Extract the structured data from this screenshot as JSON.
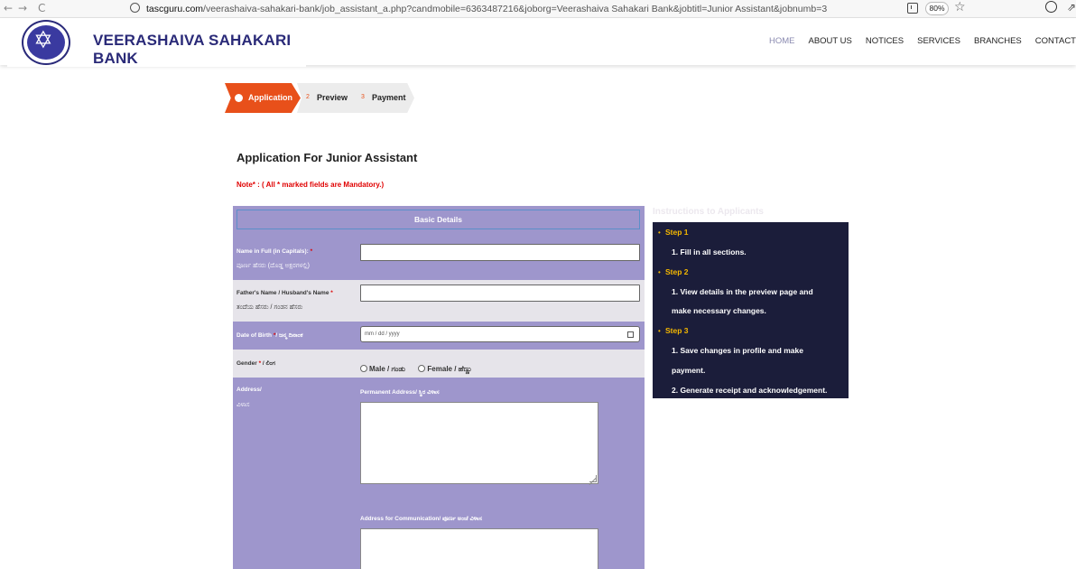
{
  "browser": {
    "back": "←",
    "forward": "→",
    "reload": "C",
    "url_host": "tascguru.com",
    "url_path": "/veerashaiva-sahakari-bank/job_assistant_a.php?candmobile=6363487216&joborg=Veerashaiva Sahakari Bank&jobtitl=Junior Assistant&jobnumb=3",
    "zoom": "80%",
    "star": "☆",
    "ext": "⇗"
  },
  "header": {
    "bank_name": "VEERASHAIVA SAHAKARI BANK",
    "nav": [
      "HOME",
      "ABOUT US",
      "NOTICES",
      "SERVICES",
      "BRANCHES",
      "CONTACT"
    ]
  },
  "stepper": {
    "steps": [
      {
        "num": "",
        "label": "Application"
      },
      {
        "num": "2",
        "label": "Preview"
      },
      {
        "num": "3",
        "label": "Payment"
      }
    ]
  },
  "page": {
    "title": "Application For Junior Assistant",
    "note": "Note* : ( All * marked fields are Mandatory.)"
  },
  "form": {
    "section_title": "Basic Details",
    "name_label": "Name in Full (in Capitals):",
    "name_sub": "ಪೂರ್ಣ ಹೆಸರು (ದೊಡ್ಡ ಅಕ್ಷರಗಳಲ್ಲಿ)",
    "father_label": "Father's Name / Husband's Name",
    "father_sub": "ತಂದೆಯ ಹೆಸರು / ಗಂಡನ ಹೆಸರು",
    "dob_label": "Date of Birth",
    "dob_sub": "/ ಜನ್ಮ ದಿನಾಂಕ",
    "dob_placeholder": "mm / dd / yyyy",
    "gender_label": "Gender",
    "gender_sub": "/ ಲಿಂಗ",
    "gender_male": "Male / ಗಂಡು",
    "gender_female": "Female / ಹೆಣ್ಣು",
    "required_mark": "*",
    "address_label": "Address/",
    "address_sub": "ವಿಳಾಸ",
    "permanent_label": "Permanent Address/ ಸ್ಥಿರ ವಿಳಾಸ",
    "communication_label": "Address for Communication/ ಪೂರ್ಣ ಅಂಚೆ ವಿಳಾಸ"
  },
  "instructions": {
    "title": "Instructions to Applicants",
    "items": [
      {
        "kind": "step",
        "text": "Step 1"
      },
      {
        "kind": "text",
        "text": "1. Fill in all sections."
      },
      {
        "kind": "step",
        "text": "Step 2"
      },
      {
        "kind": "text",
        "text": "1. View details in the preview page and"
      },
      {
        "kind": "text",
        "text": "make necessary changes."
      },
      {
        "kind": "step",
        "text": "Step 3"
      },
      {
        "kind": "text",
        "text": "1. Save changes in profile and make"
      },
      {
        "kind": "text",
        "text": "payment."
      },
      {
        "kind": "text",
        "text": "2. Generate receipt and acknowledgement."
      }
    ]
  },
  "colors": {
    "accent": "#e8501a",
    "brand": "#2a2a78",
    "form_purple": "#9e96cc",
    "instr_bg": "#1b1d3a",
    "step_yellow": "#f5b800"
  }
}
